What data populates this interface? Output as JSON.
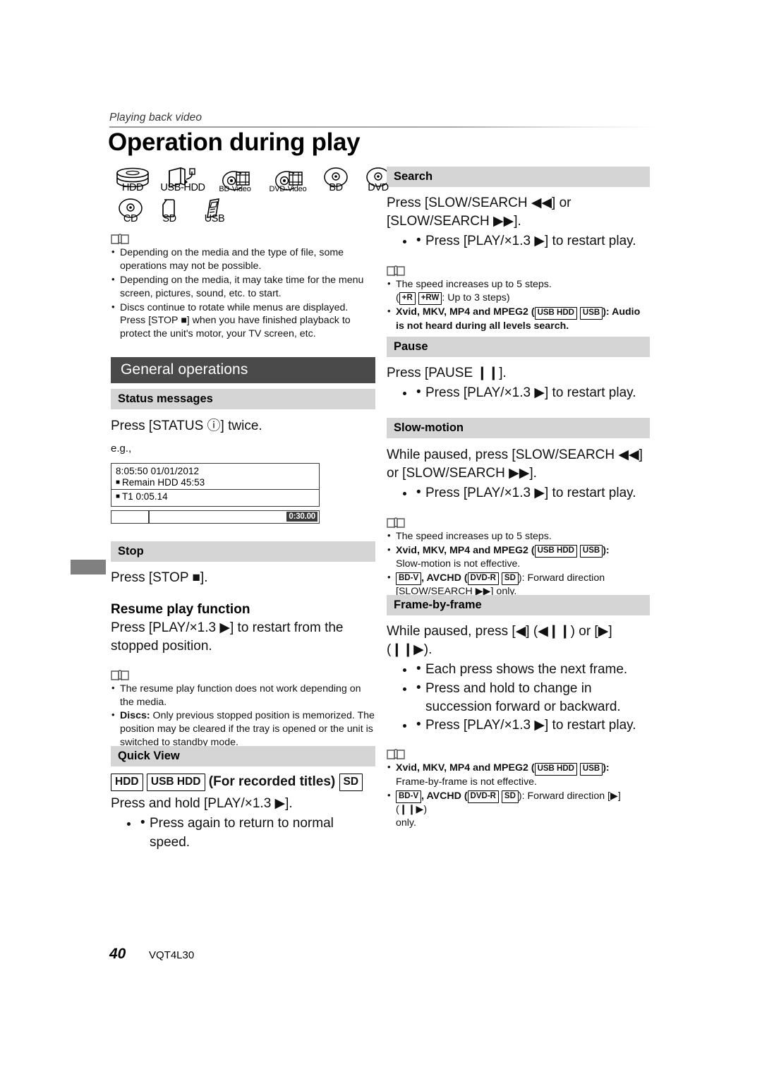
{
  "header": {
    "running_head": "Playing back video",
    "title": "Operation during play"
  },
  "media_icons": {
    "row1": [
      {
        "label": "HDD",
        "icon": "hdd-stack-icon"
      },
      {
        "label": "USB-HDD",
        "icon": "usb-hdd-icon"
      },
      {
        "label": "BD-Video",
        "icon": "bd-video-disc-icon"
      },
      {
        "label": "DVD-Video",
        "icon": "dvd-video-disc-icon"
      },
      {
        "label": "BD",
        "icon": "bd-disc-icon"
      },
      {
        "label": "DVD",
        "icon": "dvd-disc-icon"
      }
    ],
    "row2": [
      {
        "label": "CD",
        "icon": "cd-disc-icon"
      },
      {
        "label": "SD",
        "icon": "sd-card-icon"
      },
      {
        "label": "USB",
        "icon": "usb-plug-icon"
      }
    ]
  },
  "intro_notes": [
    "Depending on the media and the type of file, some operations may not be possible.",
    "Depending on the media, it may take time for the menu screen, pictures, sound, etc. to start.",
    "Discs continue to rotate while menus are displayed. Press [STOP ■] when you have finished playback to protect the unit's motor, your TV screen, etc."
  ],
  "sections": {
    "general_operations": "General operations",
    "status_messages": {
      "heading": "Status messages",
      "instruction": "Press [STATUS ⓘ] twice.",
      "example_label": "e.g.,",
      "display": {
        "line1": "8:05:50  01/01/2012",
        "line2": "Remain   HDD  45:53",
        "line3": "T1        0:05.14",
        "time": "0:30.00"
      }
    },
    "stop": {
      "heading": "Stop",
      "instruction": "Press [STOP ■].",
      "resume_heading": "Resume play function",
      "resume_instruction": "Press [PLAY/×1.3 ▶] to restart from the stopped position.",
      "notes": [
        {
          "bold": "",
          "text": "The resume play function does not work depending on the media."
        },
        {
          "bold": "Discs:",
          "text": " Only previous stopped position is memorized. The position may be cleared if the tray is opened or the unit is switched to standby mode."
        }
      ]
    },
    "quick_view": {
      "heading": "Quick View",
      "badges": [
        "HDD",
        "USB HDD"
      ],
      "badge_trailing": "SD",
      "qualifier": "(For recorded titles)",
      "instruction": "Press and hold [PLAY/×1.3 ▶].",
      "bullets": [
        "Press again to return to normal speed."
      ]
    },
    "search": {
      "heading": "Search",
      "instruction": "Press [SLOW/SEARCH ◀◀] or [SLOW/SEARCH ▶▶].",
      "bullets": [
        "Press [PLAY/×1.3 ▶] to restart play."
      ],
      "note_speed": "The speed increases up to 5 steps.",
      "note_speed_badges": [
        "+R",
        "+RW"
      ],
      "note_speed_suffix": ": Up to 3 steps)",
      "note_codec_bold": "Xvid, MKV, MP4 and MPEG2 (",
      "note_codec_badges": [
        "USB HDD",
        "USB"
      ],
      "note_codec_tail": "): Audio is not heard during all levels search."
    },
    "pause": {
      "heading": "Pause",
      "instruction": "Press [PAUSE ❙❙].",
      "bullets": [
        "Press [PLAY/×1.3 ▶] to restart play."
      ]
    },
    "slow_motion": {
      "heading": "Slow-motion",
      "instruction": "While paused, press [SLOW/SEARCH ◀◀] or [SLOW/SEARCH ▶▶].",
      "bullets": [
        "Press [PLAY/×1.3 ▶] to restart play."
      ],
      "note_speed": "The speed increases up to 5 steps.",
      "note_codec_bold": "Xvid, MKV, MP4 and MPEG2 (",
      "note_codec_badges": [
        "USB HDD",
        "USB"
      ],
      "note_codec_tail": "):",
      "note_codec_sub": "Slow-motion is not effective.",
      "note_bdv_badge": "BD-V",
      "note_bdv_bold": ", AVCHD (",
      "note_bdv_badges": [
        "DVD-R",
        "SD"
      ],
      "note_bdv_tail": "): Forward direction",
      "note_bdv_sub": "[SLOW/SEARCH ▶▶] only."
    },
    "frame_by_frame": {
      "heading": "Frame-by-frame",
      "instruction": "While paused, press [◀] (◀❙❙) or [▶] (❙❙▶).",
      "bullets": [
        "Each press shows the next frame.",
        "Press and hold to change in succession forward or backward.",
        "Press [PLAY/×1.3 ▶] to restart play."
      ],
      "note_codec_bold": "Xvid, MKV, MP4 and MPEG2 (",
      "note_codec_badges": [
        "USB HDD",
        "USB"
      ],
      "note_codec_tail": "):",
      "note_codec_sub": "Frame-by-frame is not effective.",
      "note_bdv_badge": "BD-V",
      "note_bdv_bold": ", AVCHD (",
      "note_bdv_badges": [
        "DVD-R",
        "SD"
      ],
      "note_bdv_tail": "): Forward direction [▶] (❙❙▶)",
      "note_bdv_sub": "only."
    }
  },
  "footer": {
    "page_number": "40",
    "document_code": "VQT4L30"
  },
  "colors": {
    "main_bar": "#4a4a4a",
    "sub_bar": "#d5d5d5",
    "edge_tab": "#808080",
    "text": "#000000"
  }
}
